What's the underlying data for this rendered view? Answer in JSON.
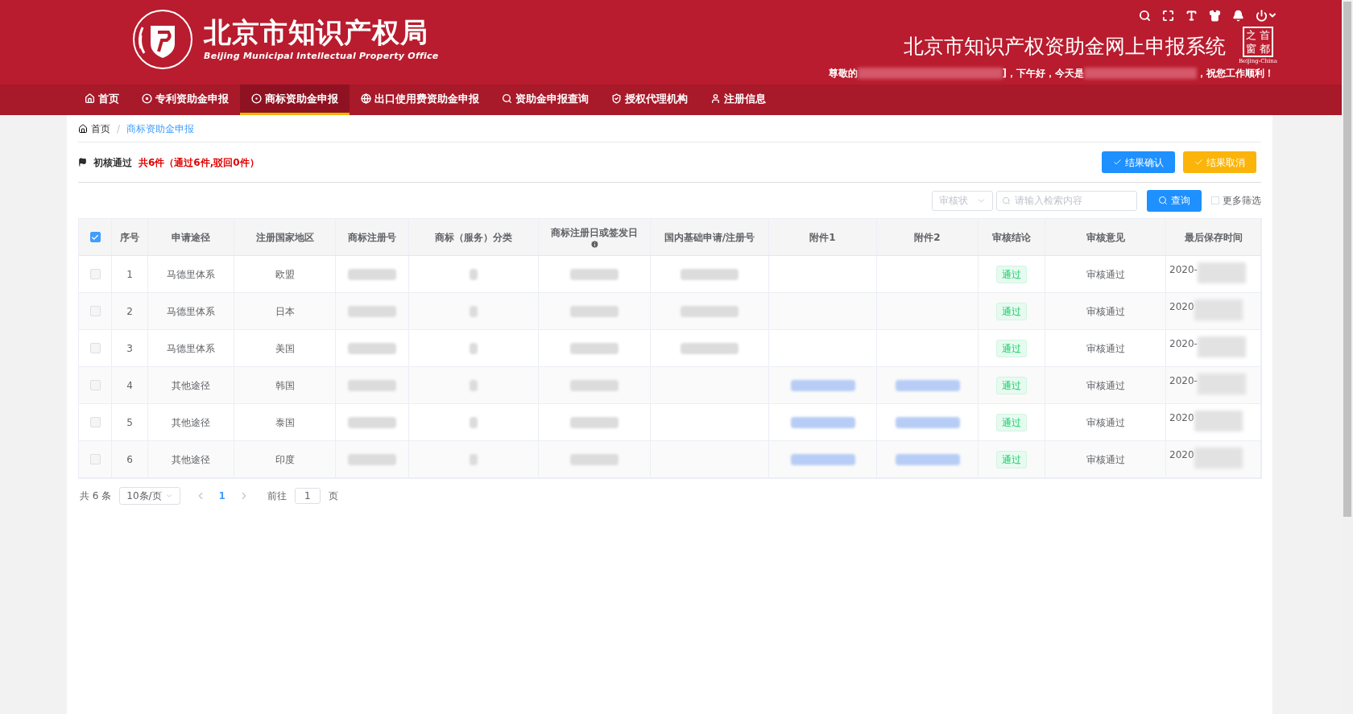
{
  "header": {
    "org_name": "北京市知识产权局",
    "org_name_en": "Beijing Municipal Intellectual Property Office",
    "system_title": "北京市知识产权资助金网上申报系统",
    "portal_logo": {
      "chars": [
        "之",
        "首",
        "窗",
        "都"
      ],
      "caption": "Beijing-China"
    },
    "greeting": {
      "prefix": "尊敬的",
      "middle": "]，下午好，今天是",
      "suffix": "，祝您工作顺利！"
    }
  },
  "nav": [
    {
      "label": "首页",
      "selected": false
    },
    {
      "label": "专利资助金申报",
      "selected": false
    },
    {
      "label": "商标资助金申报",
      "selected": true
    },
    {
      "label": "出口使用费资助金申报",
      "selected": false
    },
    {
      "label": "资助金申报查询",
      "selected": false
    },
    {
      "label": "授权代理机构",
      "selected": false
    },
    {
      "label": "注册信息",
      "selected": false
    }
  ],
  "breadcrumb_separator": "/",
  "breadcrumb": [
    {
      "label": "首页",
      "selected": false
    },
    {
      "label": "商标资助金申报",
      "selected": true
    }
  ],
  "summary": {
    "status": "初核通过",
    "count": "共6件（通过6件,驳回0件）"
  },
  "actions": [
    {
      "label": "结果确认",
      "kind": "primary"
    },
    {
      "label": "结果取消",
      "kind": "warning"
    }
  ],
  "filters": {
    "status_select": {
      "placeholder": "审核状"
    },
    "search": {
      "placeholder": "请输入检索内容"
    },
    "search_button": "查询",
    "more_filters": {
      "label": "更多筛选",
      "checked": false
    }
  },
  "table": {
    "select_all_checked": true,
    "columns": [
      {
        "label": "序号"
      },
      {
        "label": "申请途径"
      },
      {
        "label": "注册国家地区"
      },
      {
        "label": "商标注册号"
      },
      {
        "label": "商标（服务）分类"
      },
      {
        "label": "商标注册日或签发日",
        "info": true
      },
      {
        "label": "国内基础申请/注册号"
      },
      {
        "label": "附件1"
      },
      {
        "label": "附件2"
      },
      {
        "label": "审核结论"
      },
      {
        "label": "审核意见"
      },
      {
        "label": "最后保存时间"
      }
    ],
    "rows": [
      {
        "checked": false,
        "index": "1",
        "route": "马德里体系",
        "region": "欧盟",
        "base_no_redacted": true,
        "attachments_redacted": false,
        "conclusion": "通过",
        "opinion": "审核通过",
        "saved_time": "2020-"
      },
      {
        "checked": false,
        "index": "2",
        "route": "马德里体系",
        "region": "日本",
        "base_no_redacted": true,
        "attachments_redacted": false,
        "conclusion": "通过",
        "opinion": "审核通过",
        "saved_time": "2020"
      },
      {
        "checked": false,
        "index": "3",
        "route": "马德里体系",
        "region": "美国",
        "base_no_redacted": true,
        "attachments_redacted": false,
        "conclusion": "通过",
        "opinion": "审核通过",
        "saved_time": "2020-"
      },
      {
        "checked": false,
        "index": "4",
        "route": "其他途径",
        "region": "韩国",
        "base_no_redacted": false,
        "attachments_redacted": true,
        "conclusion": "通过",
        "opinion": "审核通过",
        "saved_time": "2020-"
      },
      {
        "checked": false,
        "index": "5",
        "route": "其他途径",
        "region": "泰国",
        "base_no_redacted": false,
        "attachments_redacted": true,
        "conclusion": "通过",
        "opinion": "审核通过",
        "saved_time": "2020"
      },
      {
        "checked": false,
        "index": "6",
        "route": "其他途径",
        "region": "印度",
        "base_no_redacted": false,
        "attachments_redacted": true,
        "conclusion": "通过",
        "opinion": "审核通过",
        "saved_time": "2020"
      }
    ]
  },
  "pagination": {
    "total": "共 6 条",
    "page_size": "10条/页",
    "pages": [
      {
        "label": "1",
        "selected": true
      }
    ],
    "goto_label": "前往",
    "goto_value": "1",
    "goto_suffix": "页"
  }
}
